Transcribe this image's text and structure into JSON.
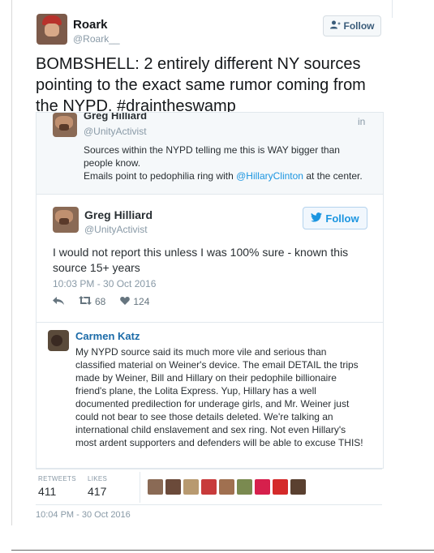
{
  "tweet": {
    "author_name": "Roark",
    "author_handle": "@Roark__",
    "follow_label": "Follow",
    "text": "BOMBSHELL: 2 entirely different NY sources pointing to the exact same rumor coming from the NYPD. #draintheswamp",
    "timestamp": "10:04 PM - 30 Oct 2016",
    "retweets_label": "RETWEETS",
    "retweets": "411",
    "likes_label": "LIKES",
    "likes": "417"
  },
  "quoted_top": {
    "name": "Greg Hilliard",
    "corner_text": "in",
    "handle": "@UnityActivist",
    "text_part1": "Sources within the NYPD telling me this is WAY bigger than people know.",
    "text_part2": "Emails point to pedophilia ring with ",
    "mention": "@HillaryClinton",
    "text_part3": " at the center."
  },
  "quoted_main": {
    "name": "Greg Hilliard",
    "handle": "@UnityActivist",
    "follow_label": "Follow",
    "text": "I would not report this unless I was 100% sure - known this source 15+ years",
    "timestamp": "10:03 PM - 30 Oct 2016",
    "retweets": "68",
    "likes": "124"
  },
  "reply": {
    "name": "Carmen Katz",
    "text": "My NYPD source said its much more vile and serious than classified material on Weiner's device. The email DETAIL the trips made by Weiner, Bill and Hillary on their pedophile billionaire friend's plane, the Lolita Express. Yup, Hillary has a well documented predilection for underage girls, and Mr. Weiner just could not bear to see those details deleted. We're talking an international child enslavement and sex ring. Not even Hillary's most ardent supporters and defenders will be able to excuse THIS!"
  },
  "colors": {
    "link": "#1b95e0",
    "muted": "#8899a6",
    "text": "#14171a"
  },
  "liker_colors": [
    "#8a6a55",
    "#6b4a3a",
    "#b89a70",
    "#c83b3b",
    "#a07050",
    "#7a8a50",
    "#d6204c",
    "#d42a2a",
    "#5a4030"
  ]
}
